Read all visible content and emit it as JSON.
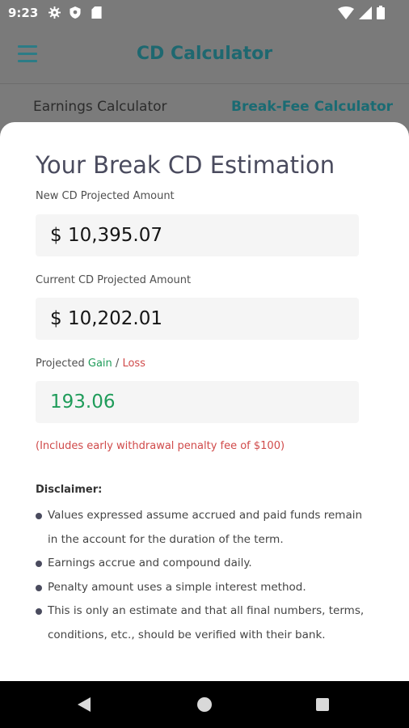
{
  "status_bar": {
    "time": "9:23",
    "icons": [
      "gear-icon",
      "shield-icon",
      "sd-card-icon",
      "wifi-icon",
      "signal-icon",
      "battery-icon"
    ]
  },
  "app_bar": {
    "title": "CD Calculator",
    "menu_icon": "menu-icon"
  },
  "tabs": {
    "earnings": "Earnings Calculator",
    "break_fee": "Break-Fee Calculator",
    "active": "break_fee"
  },
  "sheet": {
    "title": "Your Break CD Estimation",
    "new_cd": {
      "label": "New CD Projected Amount",
      "value": "$ 10,395.07"
    },
    "current_cd": {
      "label": "Current CD Projected Amount",
      "value": "$ 10,202.01"
    },
    "projected": {
      "label_prefix": "Projected ",
      "gain_word": "Gain",
      "separator": " / ",
      "loss_word": "Loss",
      "value": "193.06"
    },
    "penalty_note": "(Includes early withdrawal penalty fee of $100)",
    "disclaimer": {
      "heading": "Disclaimer:",
      "items": [
        "Values expressed assume accrued and paid funds remain in the account for the duration of the term.",
        "Earnings accrue and compound daily.",
        "Penalty amount uses a simple interest method.",
        "This is only an estimate and that all final numbers, terms, conditions, etc., should be verified with their bank."
      ]
    }
  },
  "colors": {
    "accent": "#1e6870",
    "gain": "#1f9c5a",
    "loss": "#d04a4a",
    "title": "#4a4b5e"
  },
  "nav_bar": {
    "icons": [
      "back-icon",
      "home-icon",
      "recents-icon"
    ]
  }
}
